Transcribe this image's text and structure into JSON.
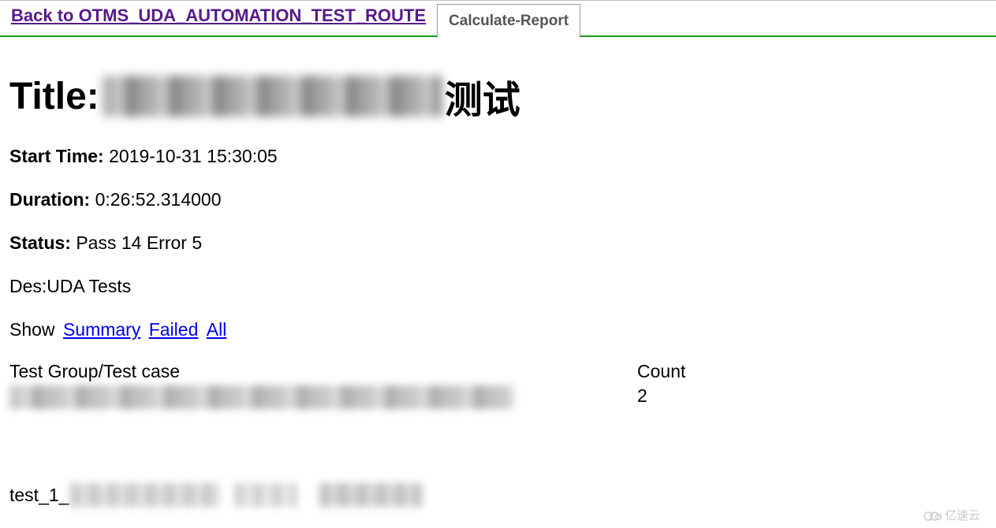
{
  "header": {
    "back_link": "Back to OTMS_UDA_AUTOMATION_TEST_ROUTE",
    "tab": "Calculate-Report"
  },
  "title": {
    "label": "Title:",
    "suffix": "测试"
  },
  "info": {
    "start_time_label": "Start Time:",
    "start_time_value": "2019-10-31 15:30:05",
    "duration_label": "Duration:",
    "duration_value": "0:26:52.314000",
    "status_label": "Status:",
    "status_value": "Pass 14 Error 5",
    "des": "Des:UDA Tests"
  },
  "filter": {
    "show_label": "Show",
    "summary": "Summary",
    "failed": "Failed",
    "all": "All"
  },
  "table": {
    "col1_header": "Test Group/Test case",
    "col2_header": "Count",
    "row1_count": "2"
  },
  "test": {
    "prefix": "test_1_"
  },
  "watermark": "亿速云"
}
